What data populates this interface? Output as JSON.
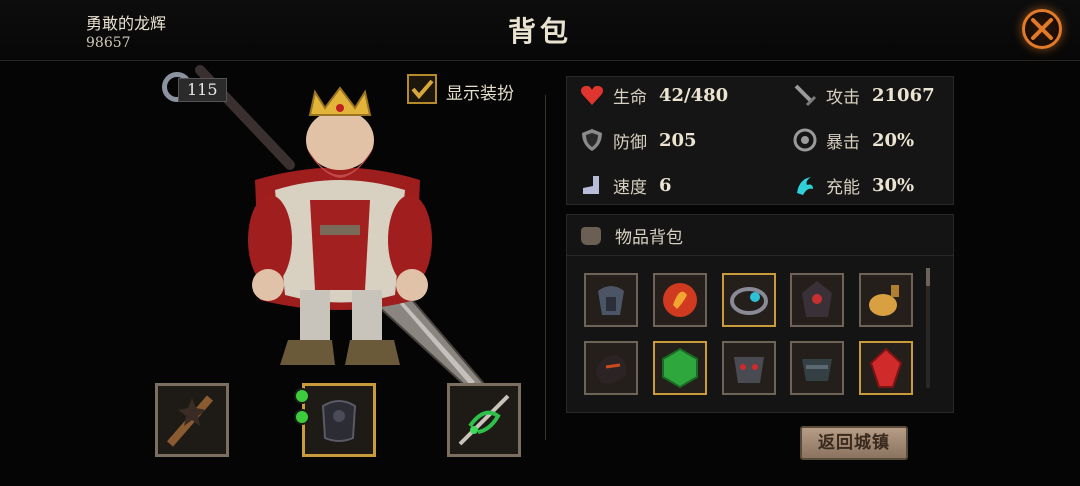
{
  "player": {
    "name": "勇敢的龙辉",
    "id": "98657"
  },
  "page_title": "背包",
  "hero": {
    "level": "115",
    "show_costume_label": "显示装扮",
    "show_costume_checked": true
  },
  "stats": {
    "life": {
      "label": "生命",
      "value": "42/480",
      "icon": "heart-icon",
      "color": "#e0352f"
    },
    "attack": {
      "label": "攻击",
      "value": "21067",
      "icon": "sword-icon"
    },
    "defense": {
      "label": "防御",
      "value": "205",
      "icon": "shield-icon"
    },
    "crit": {
      "label": "暴击",
      "value": "20%",
      "icon": "crit-icon"
    },
    "speed": {
      "label": "速度",
      "value": "6",
      "icon": "boot-icon"
    },
    "charge": {
      "label": "充能",
      "value": "30%",
      "icon": "charge-icon",
      "color": "#2fd0d8"
    }
  },
  "inventory": {
    "title": "物品背包",
    "items": [
      {
        "icon": "helmet-icon",
        "frame": "grey"
      },
      {
        "icon": "fire-orb-icon",
        "frame": "grey"
      },
      {
        "icon": "amulet-icon",
        "frame": "gold"
      },
      {
        "icon": "dark-helm-icon",
        "frame": "grey"
      },
      {
        "icon": "potion-pouch-icon",
        "frame": "grey"
      },
      {
        "icon": "dark-gauntlet-icon",
        "frame": "grey"
      },
      {
        "icon": "green-gem-icon",
        "frame": "gold"
      },
      {
        "icon": "mask-icon",
        "frame": "grey"
      },
      {
        "icon": "armor-piece-icon",
        "frame": "grey"
      },
      {
        "icon": "red-gem-icon",
        "frame": "gold"
      }
    ]
  },
  "equipment": {
    "weapon": {
      "icon": "spiked-mace-icon"
    },
    "armor": {
      "icon": "dark-armor-icon"
    },
    "accessory": {
      "icon": "vine-weapon-icon"
    }
  },
  "return_button": "返回城镇"
}
